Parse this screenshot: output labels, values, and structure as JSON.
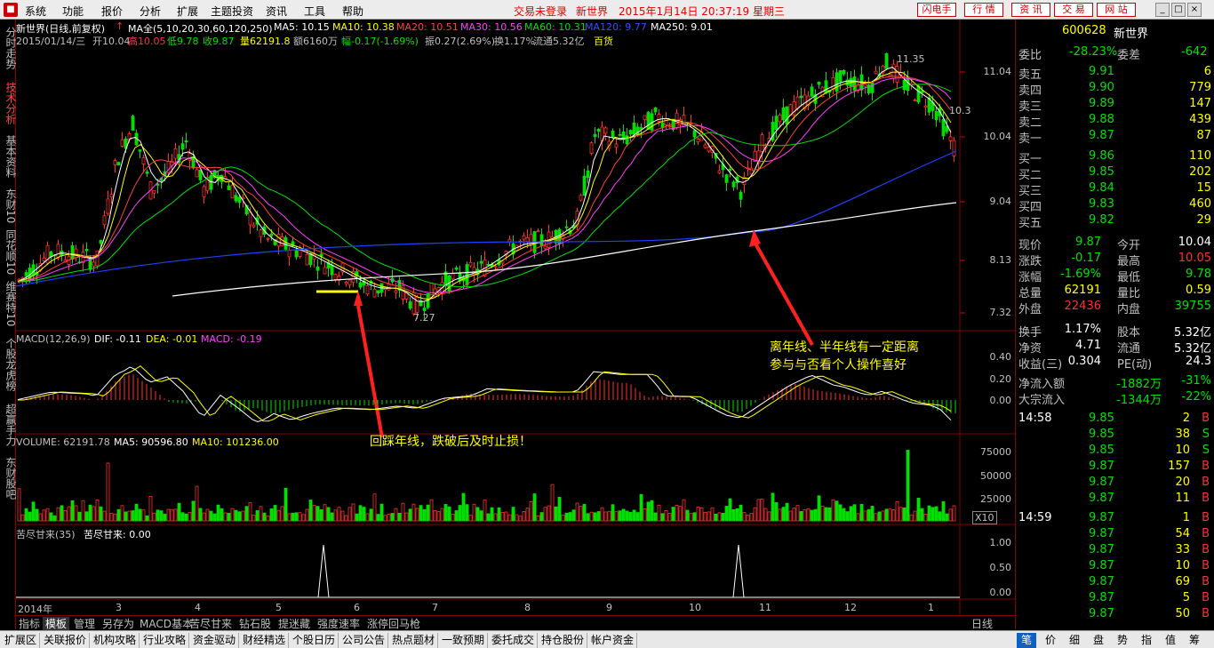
{
  "menubar": {
    "logo": "■",
    "items": [
      "系统",
      "功能",
      "报价",
      "分析",
      "扩展",
      "主题投资",
      "资讯",
      "工具",
      "帮助"
    ],
    "login_status": "交易未登录",
    "stock_name": "新世界",
    "datetime": "2015年1月14日 20:37:19 星期三",
    "btn_flash": "闪电手",
    "btn_quote": "行 情",
    "btn_info": "资 讯",
    "btn_trade": "交 易",
    "btn_net": "网 站"
  },
  "leftbar": [
    "分时走势",
    "技术分析",
    "基本资料",
    "东财10",
    "同花顺10",
    "维赛特10",
    "个股龙虎榜",
    "超赢手力",
    "东财股吧"
  ],
  "chart": {
    "title": "新世界(日线,前复权)",
    "ma_all": "MA全(5,10,20,30,60,120,250)",
    "ma5": "MA5: 10.15",
    "ma10": "MA10: 10.38",
    "ma20": "MA20: 10.51",
    "ma30": "MA30: 10.56",
    "ma60": "MA60: 10.31",
    "ma120": "MA120: 9.77",
    "ma250": "MA250: 9.01",
    "info_date": "2015/01/14/三",
    "info_open": "开10.04",
    "info_high": "高10.05",
    "info_low": "低9.78",
    "info_close": "收9.87",
    "info_vol": "量62191.8",
    "info_amt": "额6160万",
    "info_chg": "幅-0.17(-1.69%)",
    "info_amp": "振0.27(2.69%)",
    "info_turn": "换1.17%",
    "info_float": "流通5.32亿",
    "info_sector": "百货",
    "price_axis": [
      "11.04",
      "10.04",
      "9.04",
      "8.13",
      "7.32"
    ],
    "high_label": "11.35",
    "low_label": "7.27",
    "right_label": "10.3",
    "annotation_right_1": "离年线、半年线有一定距离",
    "annotation_right_2": "参与与否看个人操作喜好",
    "annotation_left": "回踩年线，跌破后及时止损！",
    "macd_title": "MACD(12,26,9)",
    "macd_dif": "DIF: -0.11",
    "macd_dea": "DEA: -0.01",
    "macd_val": "MACD: -0.19",
    "macd_axis": [
      "0.40",
      "0.20",
      "0.00"
    ],
    "vol_title": "VOLUME: 62191.78",
    "vol_ma5": "MA5: 90596.80",
    "vol_ma10": "MA10: 101236.00",
    "vol_axis": [
      "75000",
      "50000",
      "25000"
    ],
    "vol_unit": "X10",
    "ind_title": "苦尽甘来(35)",
    "ind_val": "苦尽甘来: 0.00",
    "ind_axis": [
      "1.00",
      "0.50",
      "0.00"
    ],
    "time_axis": [
      "2014年",
      "3",
      "4",
      "5",
      "6",
      "7",
      "8",
      "9",
      "10",
      "11",
      "12",
      "1"
    ],
    "period": "日线"
  },
  "chart_data": {
    "type": "candlestick",
    "note_series": [
      "price",
      "macd",
      "volume",
      "indicator"
    ],
    "price_range": [
      7.1,
      11.5
    ],
    "dates_start": "2014-01",
    "dates_end": "2015-01-14",
    "last": {
      "open": 10.04,
      "high": 10.05,
      "low": 9.78,
      "close": 9.87,
      "volume": 62191.8
    },
    "ma": {
      "MA5": 10.15,
      "MA10": 10.38,
      "MA20": 10.51,
      "MA30": 10.56,
      "MA60": 10.31,
      "MA120": 9.77,
      "MA250": 9.01
    },
    "macd": {
      "DIF": -0.11,
      "DEA": -0.01,
      "MACD": -0.19
    },
    "indicator_spikes": [
      "5月底",
      "10月底"
    ]
  },
  "bottom_tabs": [
    "指标",
    "模板",
    "管理",
    "另存为",
    "MACD基本",
    "苦尽甘来",
    "钻石股",
    "提迷藏",
    "强度速率",
    "涨停回马枪"
  ],
  "bottom_nav": [
    "扩展区",
    "关联报价",
    "机构攻略",
    "行业攻略",
    "资金驱动",
    "财经精选",
    "个股日历",
    "公司公告",
    "热点题材",
    "一致预期",
    "委托成交",
    "持仓股份",
    "帐户资金"
  ],
  "right_tabs": [
    "笔",
    "价",
    "细",
    "盘",
    "势",
    "指",
    "值",
    "筹"
  ],
  "quote": {
    "code": "600628",
    "name": "新世界",
    "weibi_label": "委比",
    "weibi": "-28.23%",
    "weicha_label": "委差",
    "weicha": "-642",
    "sells": [
      {
        "label": "卖五",
        "price": "9.91",
        "vol": "6"
      },
      {
        "label": "卖四",
        "price": "9.90",
        "vol": "779"
      },
      {
        "label": "卖三",
        "price": "9.89",
        "vol": "147"
      },
      {
        "label": "卖二",
        "price": "9.88",
        "vol": "439"
      },
      {
        "label": "卖一",
        "price": "9.87",
        "vol": "87"
      }
    ],
    "buys": [
      {
        "label": "买一",
        "price": "9.86",
        "vol": "110"
      },
      {
        "label": "买二",
        "price": "9.85",
        "vol": "202"
      },
      {
        "label": "买三",
        "price": "9.84",
        "vol": "15"
      },
      {
        "label": "买四",
        "price": "9.83",
        "vol": "460"
      },
      {
        "label": "买五",
        "price": "9.82",
        "vol": "29"
      }
    ],
    "stats": [
      {
        "l1": "现价",
        "v1": "9.87",
        "l2": "今开",
        "v2": "10.04",
        "c1": "grn",
        "c2": "wht"
      },
      {
        "l1": "涨跌",
        "v1": "-0.17",
        "l2": "最高",
        "v2": "10.05",
        "c1": "grn",
        "c2": "red"
      },
      {
        "l1": "涨幅",
        "v1": "-1.69%",
        "l2": "最低",
        "v2": "9.78",
        "c1": "grn",
        "c2": "grn"
      },
      {
        "l1": "总量",
        "v1": "62191",
        "l2": "量比",
        "v2": "0.59",
        "c1": "yel",
        "c2": "yel"
      },
      {
        "l1": "外盘",
        "v1": "22436",
        "l2": "内盘",
        "v2": "39755",
        "c1": "red",
        "c2": "grn"
      }
    ],
    "stats2": [
      {
        "l1": "换手",
        "v1": "1.17%",
        "l2": "股本",
        "v2": "5.32亿"
      },
      {
        "l1": "净资",
        "v1": "4.71",
        "l2": "流通",
        "v2": "5.32亿"
      },
      {
        "l1": "收益(三)",
        "v1": "0.304",
        "l2": "PE(动)",
        "v2": "24.3"
      }
    ],
    "flow": [
      {
        "label": "净流入额",
        "v1": "-1882万",
        "v2": "-31%"
      },
      {
        "label": "大宗流入",
        "v1": "-1344万",
        "v2": "-22%"
      }
    ],
    "ticks": [
      {
        "time": "14:58",
        "price": "9.85",
        "vol": "2",
        "side": "B"
      },
      {
        "time": "",
        "price": "9.85",
        "vol": "38",
        "side": "S"
      },
      {
        "time": "",
        "price": "9.85",
        "vol": "10",
        "side": "S"
      },
      {
        "time": "",
        "price": "9.87",
        "vol": "157",
        "side": "B"
      },
      {
        "time": "",
        "price": "9.87",
        "vol": "20",
        "side": "B"
      },
      {
        "time": "",
        "price": "9.87",
        "vol": "11",
        "side": "B"
      },
      {
        "time": "14:59",
        "price": "9.87",
        "vol": "1",
        "side": "B"
      },
      {
        "time": "",
        "price": "9.87",
        "vol": "54",
        "side": "B"
      },
      {
        "time": "",
        "price": "9.87",
        "vol": "33",
        "side": "B"
      },
      {
        "time": "",
        "price": "9.87",
        "vol": "10",
        "side": "B"
      },
      {
        "time": "",
        "price": "9.87",
        "vol": "69",
        "side": "B"
      },
      {
        "time": "",
        "price": "9.87",
        "vol": "5",
        "side": "B"
      },
      {
        "time": "",
        "price": "9.87",
        "vol": "50",
        "side": "B"
      }
    ]
  }
}
